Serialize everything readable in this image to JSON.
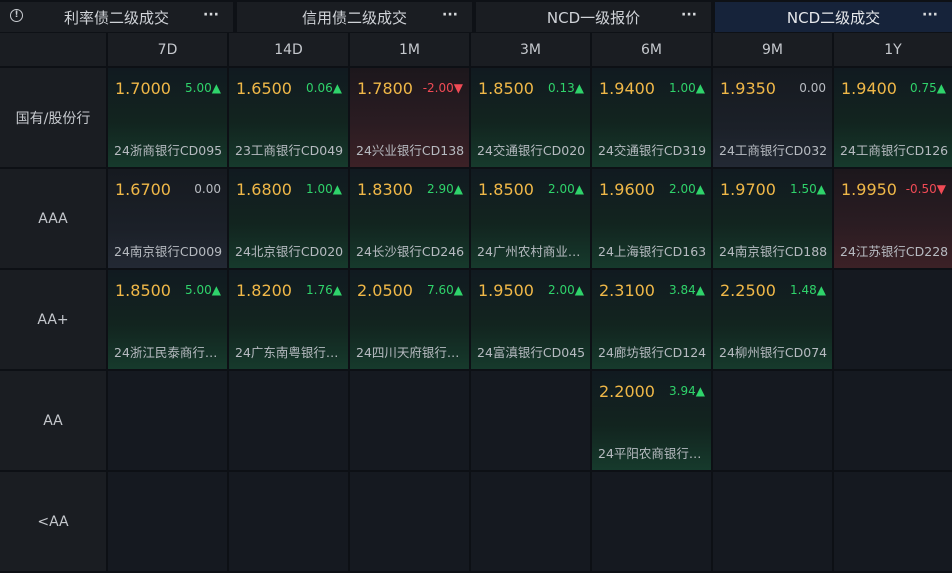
{
  "tabs": [
    {
      "label": "利率债二级成交",
      "more": "···",
      "active": false,
      "info": "!"
    },
    {
      "label": "信用债二级成交",
      "more": "···",
      "active": false
    },
    {
      "label": "NCD一级报价",
      "more": "···",
      "active": false
    },
    {
      "label": "NCD二级成交",
      "more": "···",
      "active": true
    }
  ],
  "columns": [
    "7D",
    "14D",
    "1M",
    "3M",
    "6M",
    "9M",
    "1Y"
  ],
  "rows": [
    {
      "label": "国有/股份行",
      "cells": [
        {
          "price": "1.7000",
          "change": "5.00▲",
          "trend": "up",
          "bond": "24浙商银行CD095"
        },
        {
          "price": "1.6500",
          "change": "0.06▲",
          "trend": "up",
          "bond": "23工商银行CD049"
        },
        {
          "price": "1.7800",
          "change": "-2.00▼",
          "trend": "down",
          "bond": "24兴业银行CD138"
        },
        {
          "price": "1.8500",
          "change": "0.13▲",
          "trend": "up",
          "bond": "24交通银行CD020"
        },
        {
          "price": "1.9400",
          "change": "1.00▲",
          "trend": "up",
          "bond": "24交通银行CD319"
        },
        {
          "price": "1.9350",
          "change": "0.00",
          "trend": "flat",
          "bond": "24工商银行CD032"
        },
        {
          "price": "1.9400",
          "change": "0.75▲",
          "trend": "up",
          "bond": "24工商银行CD126"
        }
      ]
    },
    {
      "label": "AAA",
      "cells": [
        {
          "price": "1.6700",
          "change": "0.00",
          "trend": "flat",
          "bond": "24南京银行CD009"
        },
        {
          "price": "1.6800",
          "change": "1.00▲",
          "trend": "up",
          "bond": "24北京银行CD020"
        },
        {
          "price": "1.8300",
          "change": "2.90▲",
          "trend": "up",
          "bond": "24长沙银行CD246"
        },
        {
          "price": "1.8500",
          "change": "2.00▲",
          "trend": "up",
          "bond": "24广州农村商业银..."
        },
        {
          "price": "1.9600",
          "change": "2.00▲",
          "trend": "up",
          "bond": "24上海银行CD163"
        },
        {
          "price": "1.9700",
          "change": "1.50▲",
          "trend": "up",
          "bond": "24南京银行CD188"
        },
        {
          "price": "1.9950",
          "change": "-0.50▼",
          "trend": "down",
          "bond": "24江苏银行CD228"
        }
      ]
    },
    {
      "label": "AA+",
      "cells": [
        {
          "price": "1.8500",
          "change": "5.00▲",
          "trend": "up",
          "bond": "24浙江民泰商行CD..."
        },
        {
          "price": "1.8200",
          "change": "1.76▲",
          "trend": "up",
          "bond": "24广东南粤银行CD..."
        },
        {
          "price": "2.0500",
          "change": "7.60▲",
          "trend": "up",
          "bond": "24四川天府银行CD..."
        },
        {
          "price": "1.9500",
          "change": "2.00▲",
          "trend": "up",
          "bond": "24富滇银行CD045"
        },
        {
          "price": "2.3100",
          "change": "3.84▲",
          "trend": "up",
          "bond": "24廊坊银行CD124"
        },
        {
          "price": "2.2500",
          "change": "1.48▲",
          "trend": "up",
          "bond": "24柳州银行CD074"
        },
        null
      ]
    },
    {
      "label": "AA",
      "cells": [
        null,
        null,
        null,
        null,
        {
          "price": "2.2000",
          "change": "3.94▲",
          "trend": "up",
          "bond": "24平阳农商银行CD..."
        },
        null,
        null
      ]
    },
    {
      "label": "<AA",
      "cells": [
        null,
        null,
        null,
        null,
        null,
        null,
        null
      ]
    }
  ]
}
